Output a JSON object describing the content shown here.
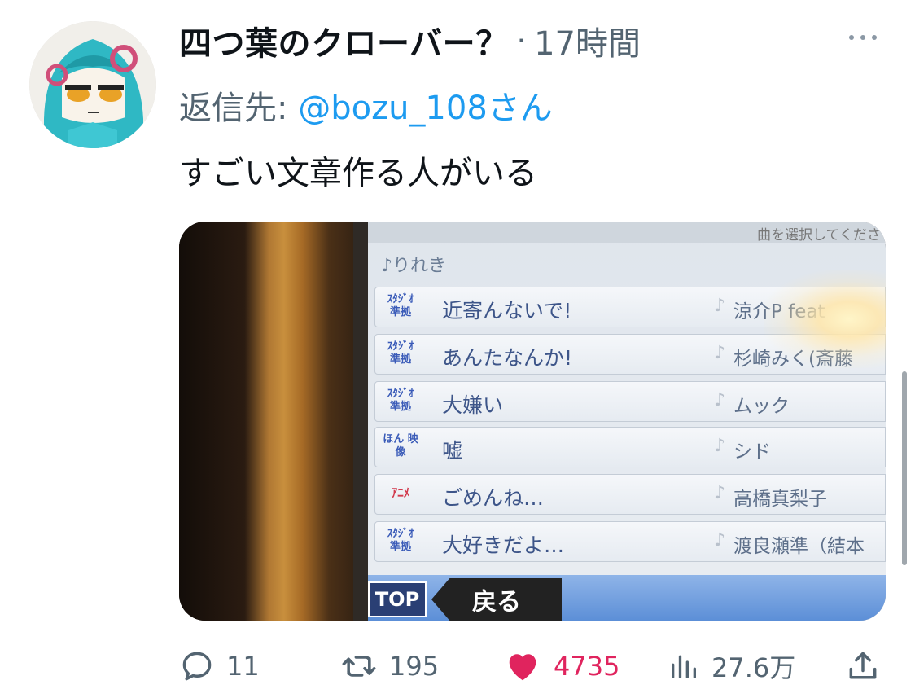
{
  "tweet": {
    "display_name": "四つ葉のクローバー？",
    "separator": "·",
    "timestamp": "17時間",
    "reply_prefix": "返信先:",
    "reply_handle": "@bozu_108さん",
    "text": "すごい文章作る人がいる"
  },
  "media": {
    "history_label": "♪りれき",
    "top_info": "曲を選択してくださ",
    "rows": [
      {
        "badge": "ｽﾀｼﾞｵ 準拠",
        "title": "近寄んないで!",
        "artist": "涼介P feat"
      },
      {
        "badge": "ｽﾀｼﾞｵ 準拠",
        "title": "あんたなんか!",
        "artist": "杉崎みく(斎藤"
      },
      {
        "badge": "ｽﾀｼﾞｵ 準拠",
        "title": "大嫌い",
        "artist": "ムック"
      },
      {
        "badge": "ほん 映像",
        "title": "嘘",
        "artist": "シド"
      },
      {
        "badge": "ｱﾆﾒ",
        "title": "ごめんね…",
        "artist": "高橋真梨子"
      },
      {
        "badge": "ｽﾀｼﾞｵ 準拠",
        "title": "大好きだよ…",
        "artist": "渡良瀬準（結本"
      }
    ],
    "top_button": "TOP",
    "back_button": "戻る"
  },
  "actions": {
    "replies": "11",
    "retweets": "195",
    "likes": "4735",
    "views": "27.6万"
  },
  "icons": [
    "more-icon",
    "reply-icon",
    "retweet-icon",
    "heart-icon",
    "views-icon",
    "share-icon"
  ],
  "colors": {
    "accent": "#1d9bf0",
    "like": "#e0245e",
    "muted": "#536471"
  }
}
